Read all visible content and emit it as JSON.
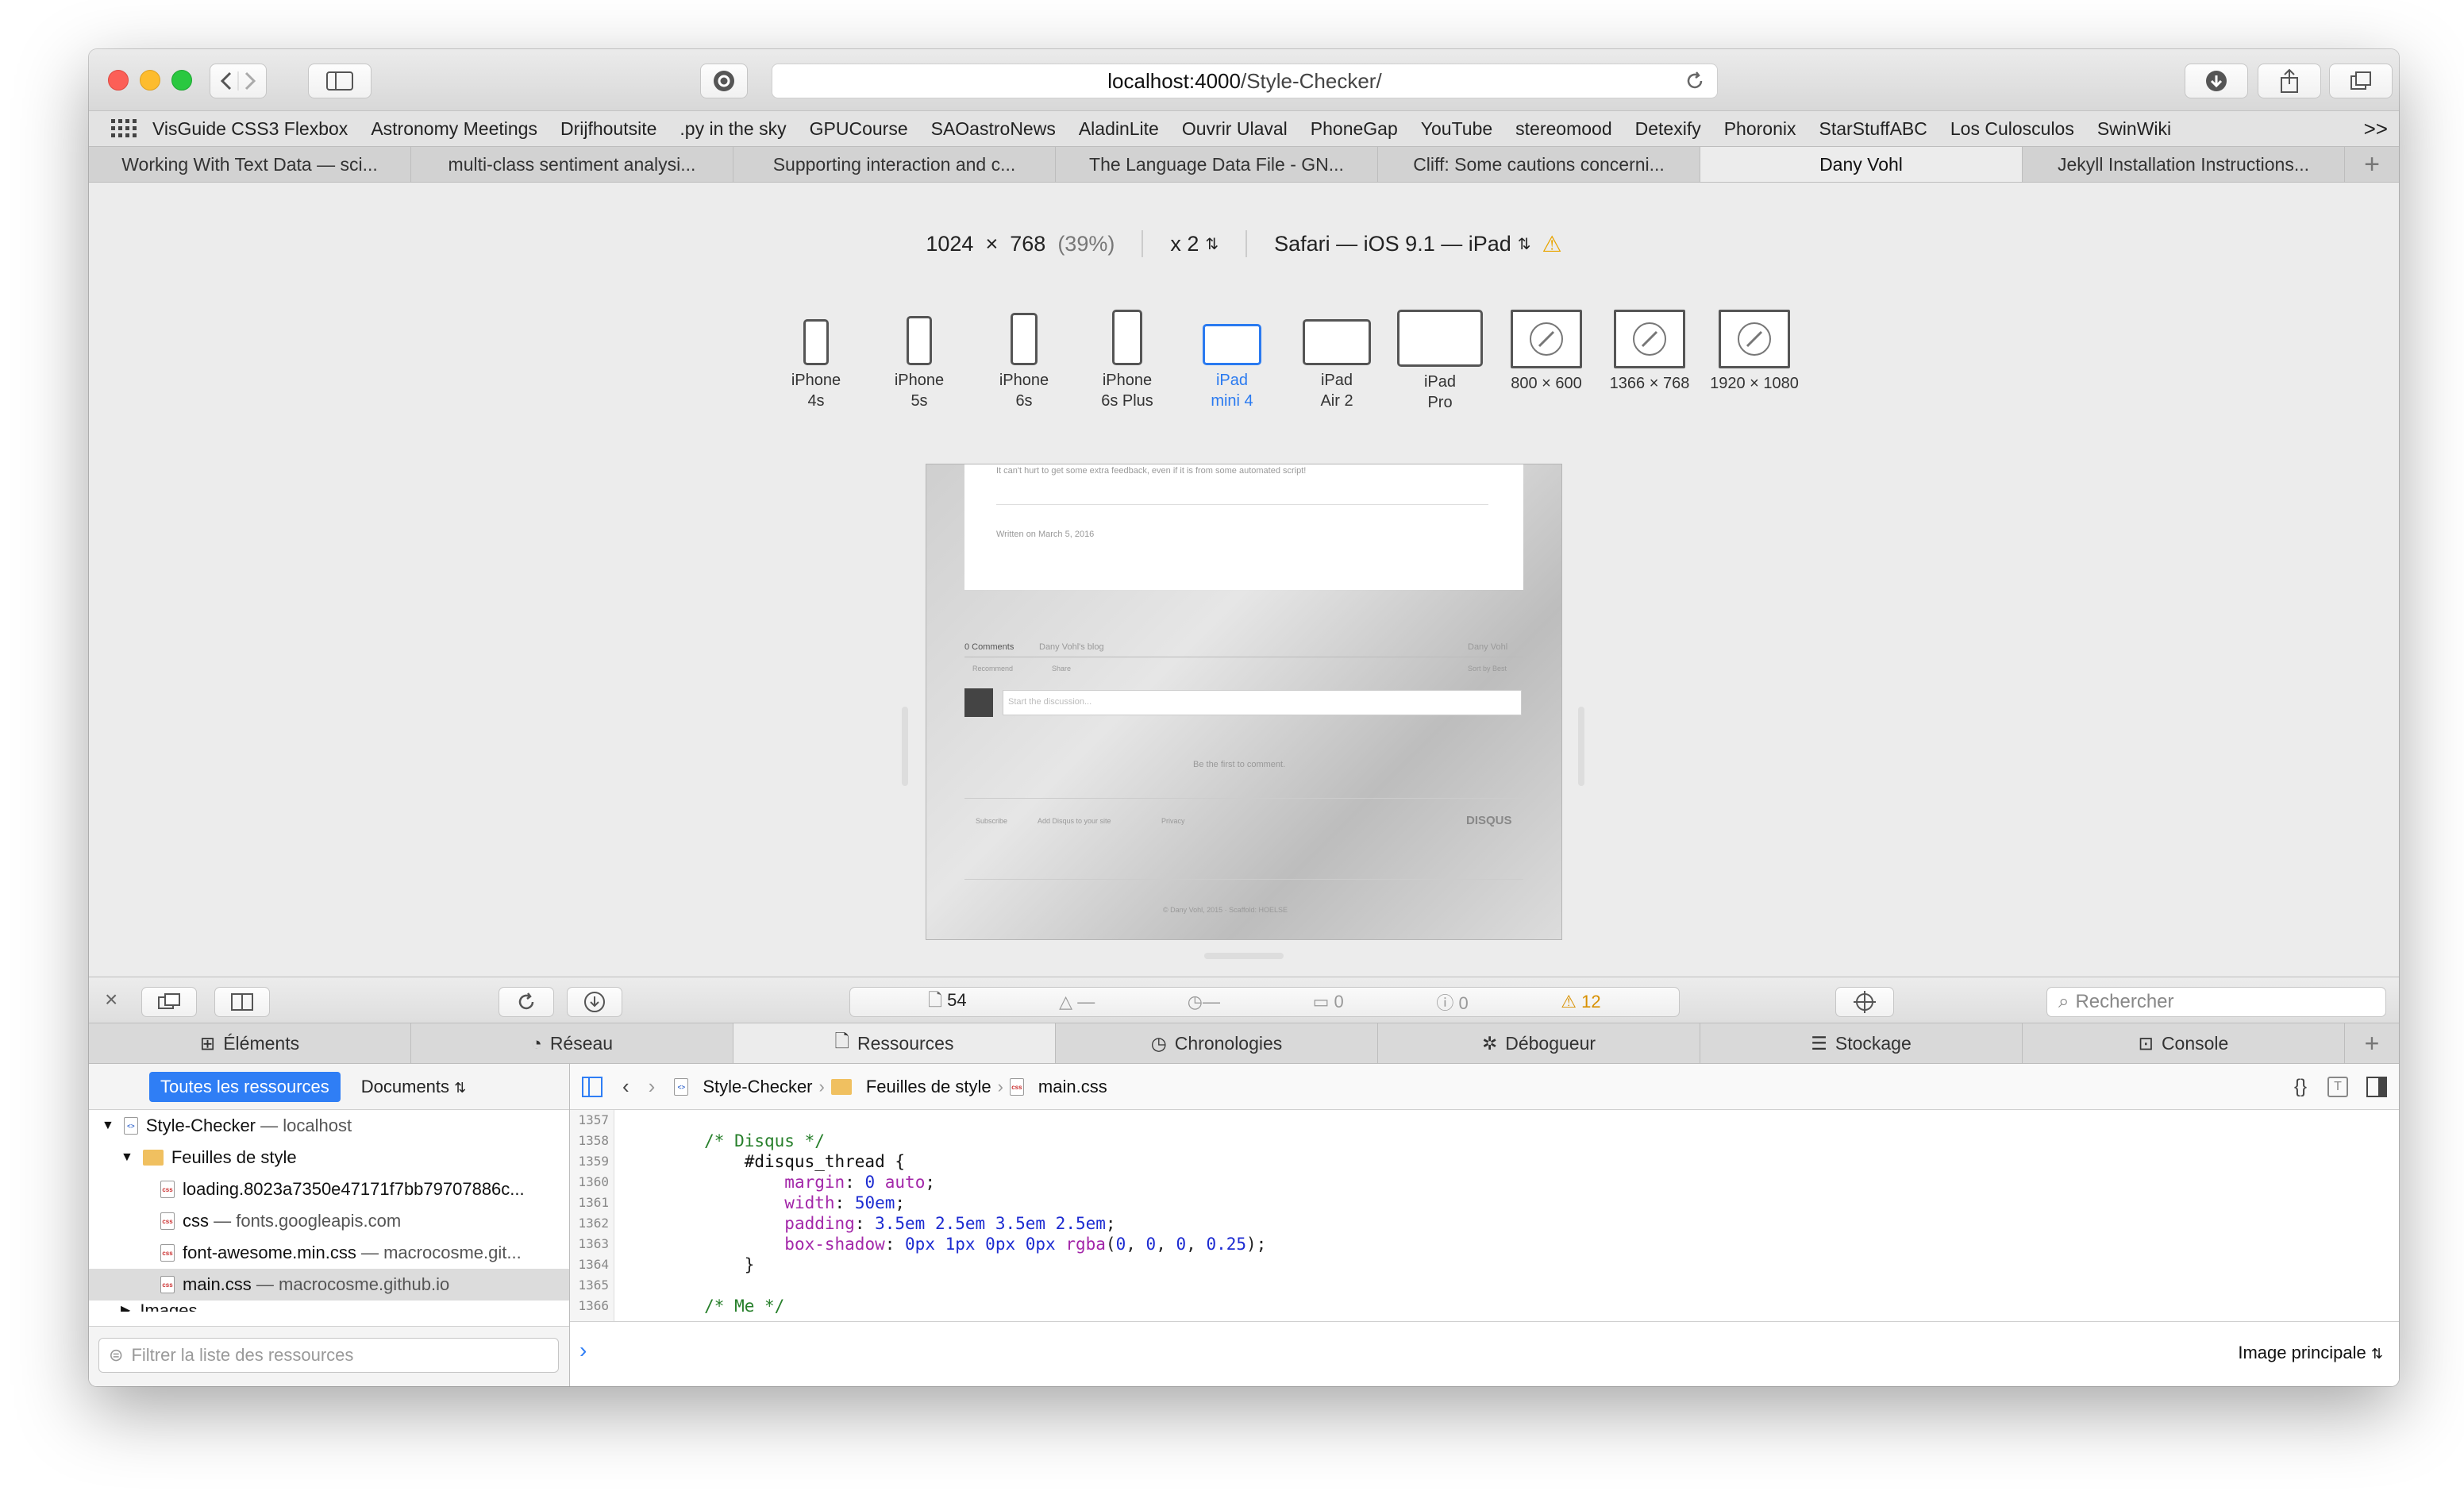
{
  "window": {
    "url_host": "localhost:4000",
    "url_path": "/Style-Checker/"
  },
  "bookmarks": [
    "VisGuide CSS3 Flexbox",
    "Astronomy Meetings",
    "Drijfhoutsite",
    ".py in the sky",
    "GPUCourse",
    "SAOastroNews",
    "AladinLite",
    "Ouvrir Ulaval",
    "PhoneGap",
    "YouTube",
    "stereomood",
    "Detexify",
    "Phoronix",
    "StarStuffABC",
    "Los Culosculos",
    "SwinWiki"
  ],
  "tabs": [
    "Working With Text Data — sci...",
    "multi-class sentiment analysi...",
    "Supporting interaction and c...",
    "The Language Data File - GN...",
    "Cliff: Some cautions concerni...",
    "Dany Vohl",
    "Jekyll Installation Instructions..."
  ],
  "active_tab_index": 5,
  "rdm": {
    "width": "1024",
    "times": "×",
    "height": "768",
    "percent": "(39%)",
    "scale": "x 2",
    "browser": "Safari — iOS 9.1 — iPad"
  },
  "devices": [
    {
      "l1": "iPhone",
      "l2": "4s"
    },
    {
      "l1": "iPhone",
      "l2": "5s"
    },
    {
      "l1": "iPhone",
      "l2": "6s"
    },
    {
      "l1": "iPhone",
      "l2": "6s Plus"
    },
    {
      "l1": "iPad",
      "l2": "mini 4"
    },
    {
      "l1": "iPad",
      "l2": "Air 2"
    },
    {
      "l1": "iPad",
      "l2": "Pro"
    },
    {
      "l1": "800 × 600",
      "l2": ""
    },
    {
      "l1": "1366 × 768",
      "l2": ""
    },
    {
      "l1": "1920 × 1080",
      "l2": ""
    }
  ],
  "preview": {
    "line1": "It can't hurt to get some extra feedback, even if it is from some automated script!",
    "written": "Written on March 5, 2016",
    "comments": "0 Comments",
    "blog": "Dany Vohl's blog",
    "user": "Dany Vohl",
    "recommend": "Recommend",
    "share": "Share",
    "sort": "Sort by Best",
    "discuss": "Start the discussion...",
    "first": "Be the first to comment.",
    "subscribe": "Subscribe",
    "add_disqus": "Add Disqus to your site",
    "privacy": "Privacy",
    "disqus": "DISQUS",
    "footer": "© Dany Vohl, 2015 · Scaffold: HOELSE"
  },
  "activity": {
    "resources": "54",
    "a": "—",
    "b": "—",
    "c": "0",
    "d": "0",
    "warnings": "12"
  },
  "search_placeholder": "Rechercher",
  "inspector_tabs": [
    "Éléments",
    "Réseau",
    "Ressources",
    "Chronologies",
    "Débogueur",
    "Stockage",
    "Console"
  ],
  "active_inspector_tab": 2,
  "sidebar": {
    "all": "Toutes les ressources",
    "docs": "Documents",
    "filter_placeholder": "Filtrer la liste des ressources",
    "tree": [
      {
        "name": "Style-Checker",
        "host": "— localhost"
      },
      {
        "name": "Feuilles de style",
        "host": ""
      },
      {
        "name": "loading.8023a7350e47171f7bb79707886c...",
        "host": ""
      },
      {
        "name": "css",
        "host": "— fonts.googleapis.com"
      },
      {
        "name": "font-awesome.min.css",
        "host": "— macrocosme.git..."
      },
      {
        "name": "main.css",
        "host": "— macrocosme.github.io"
      },
      {
        "name": "Images",
        "host": ""
      }
    ]
  },
  "breadcrumb": [
    "Style-Checker",
    "Feuilles de style",
    "main.css"
  ],
  "code": {
    "line_numbers": [
      "1357",
      "1358",
      "1359",
      "1360",
      "1361",
      "1362",
      "1363",
      "1364",
      "1365",
      "1366"
    ]
  },
  "console": {
    "context": "Image principale"
  }
}
